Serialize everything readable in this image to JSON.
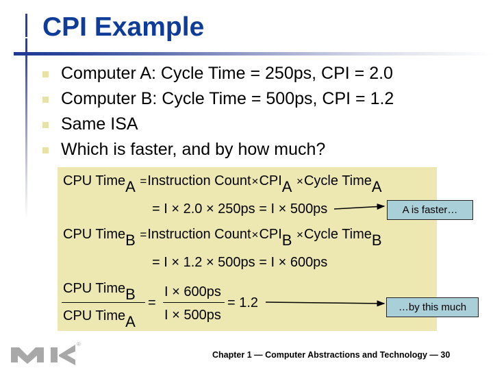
{
  "slide": {
    "title": "CPI Example",
    "bullets": [
      "Computer A: Cycle Time = 250ps, CPI = 2.0",
      "Computer B: Cycle Time = 500ps, CPI = 1.2",
      "Same ISA",
      "Which is faster, and by how much?"
    ],
    "formulas": {
      "line1": {
        "lhs": "CPU Time",
        "lhs_sub": "A",
        "eq": "=",
        "t1": "Instruction Count",
        "x1": "×",
        "t2": "CPI",
        "t2_sub": "A",
        "x2": "×",
        "t3": "Cycle Time",
        "t3_sub": "A"
      },
      "line2": {
        "text": "= I × 2.0 × 250ps = I × 500ps"
      },
      "line3": {
        "lhs": "CPU Time",
        "lhs_sub": "B",
        "eq": "=",
        "t1": "Instruction Count",
        "x1": "×",
        "t2": "CPI",
        "t2_sub": "B",
        "x2": "×",
        "t3": "Cycle Time",
        "t3_sub": "B"
      },
      "line4": {
        "text": "= I × 1.2 × 500ps = I × 600ps"
      },
      "ratio": {
        "num_lhs": "CPU Time",
        "num_lhs_sub": "B",
        "den_lhs": "CPU Time",
        "den_lhs_sub": "A",
        "eq1": "=",
        "num_rhs": "I × 600ps",
        "den_rhs": "I × 500ps",
        "result": "= 1.2"
      }
    },
    "callouts": {
      "faster": "A is faster…",
      "how_much": "…by this much"
    },
    "footer": "Chapter 1 — Computer Abstractions and Technology — 30",
    "logo": {
      "text": "MK",
      "registered": "®"
    },
    "colors": {
      "title": "#0f3c99",
      "formula_bg": "#ede8b2",
      "callout_bg": "#a9cfd9",
      "bullet": "#e6e2a8"
    }
  }
}
